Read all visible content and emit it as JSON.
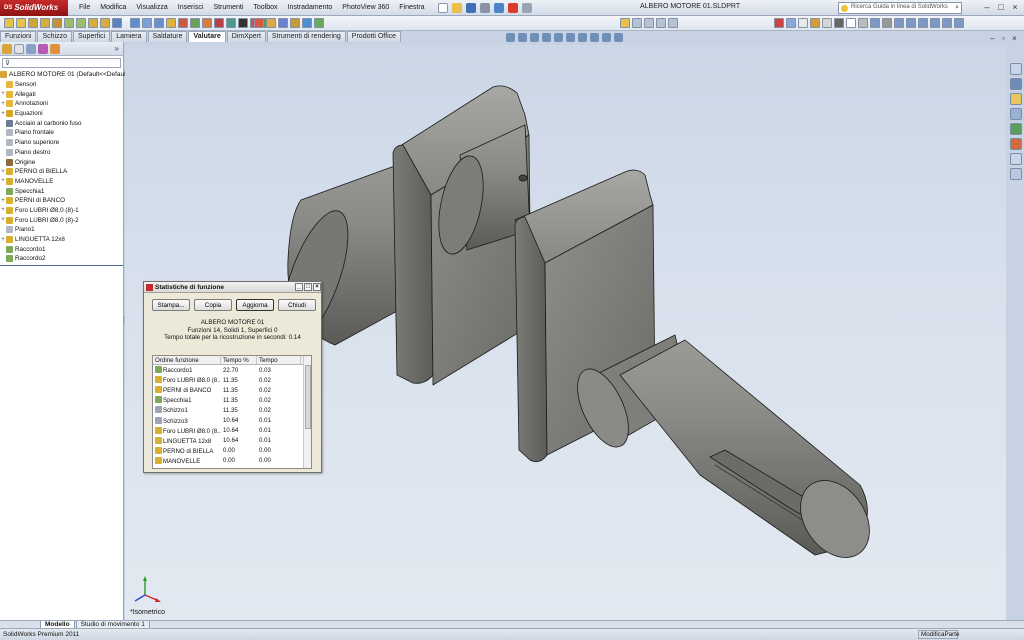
{
  "app": {
    "logo": "SolidWorks",
    "logo_prefix": "DS",
    "doc_title": "ALBERO MOTORE 01.SLDPRT"
  },
  "menu": [
    "File",
    "Modifica",
    "Visualizza",
    "Inserisci",
    "Strumenti",
    "Toolbox",
    "Instradamento",
    "PhotoView 360",
    "Finestra"
  ],
  "help_search": {
    "placeholder": "Ricerca Guida in linea di SolidWorks"
  },
  "command_tabs": [
    {
      "label": "Funzioni"
    },
    {
      "label": "Schizzo"
    },
    {
      "label": "Superfici"
    },
    {
      "label": "Lamiera"
    },
    {
      "label": "Saldature"
    },
    {
      "label": "Valutare",
      "active": true
    },
    {
      "label": "DimXpert"
    },
    {
      "label": "Strumenti di rendering"
    },
    {
      "label": "Prodotti Office"
    }
  ],
  "feature_tree": {
    "filter_icon": "filter-icon",
    "root": "ALBERO MOTORE 01  (Default<<Default>_",
    "items": [
      {
        "label": "Sensori",
        "icon": "sensor-icon",
        "color": "#e9b53c",
        "expand": ""
      },
      {
        "label": "Allegati",
        "icon": "attachment-icon",
        "color": "#e9b53c",
        "expand": "+"
      },
      {
        "label": "Annotazioni",
        "icon": "annotation-icon",
        "color": "#e9b53c",
        "expand": "+"
      },
      {
        "label": "Equazioni",
        "icon": "equation-icon",
        "color": "#d7a629",
        "expand": "+"
      },
      {
        "label": "Acciaio al carbonio fuso",
        "icon": "material-icon",
        "color": "#6b7a95",
        "expand": ""
      },
      {
        "label": "Piano frontale",
        "icon": "plane-icon",
        "color": "#b0b8c4",
        "expand": ""
      },
      {
        "label": "Piano superiore",
        "icon": "plane-icon",
        "color": "#b0b8c4",
        "expand": ""
      },
      {
        "label": "Piano destro",
        "icon": "plane-icon",
        "color": "#b0b8c4",
        "expand": ""
      },
      {
        "label": "Origine",
        "icon": "origin-icon",
        "color": "#8b6b3b",
        "expand": ""
      },
      {
        "label": "PERNO di BIELLA",
        "icon": "extrude-icon",
        "color": "#d7b030",
        "expand": "+"
      },
      {
        "label": "MANOVELLE",
        "icon": "extrude-icon",
        "color": "#d7b030",
        "expand": "+"
      },
      {
        "label": "Specchia1",
        "icon": "mirror-icon",
        "color": "#7ea85a",
        "expand": ""
      },
      {
        "label": "PERNI di BANCO",
        "icon": "extrude-icon",
        "color": "#d7b030",
        "expand": "+"
      },
      {
        "label": "Foro LUBRI Ø8.0 (8)-1",
        "icon": "hole-icon",
        "color": "#d7b030",
        "expand": "+"
      },
      {
        "label": "Foro LUBRI Ø8.0 (8)-2",
        "icon": "hole-icon",
        "color": "#d7b030",
        "expand": "+"
      },
      {
        "label": "Piano1",
        "icon": "plane-icon",
        "color": "#b0b8c4",
        "expand": ""
      },
      {
        "label": "LINGUETTA 12x8",
        "icon": "cut-icon",
        "color": "#d7b030",
        "expand": "+"
      },
      {
        "label": "Raccordo1",
        "icon": "fillet-icon",
        "color": "#7ea85a",
        "expand": ""
      },
      {
        "label": "Raccordo2",
        "icon": "fillet-icon",
        "color": "#7ea85a",
        "expand": ""
      }
    ]
  },
  "dialog": {
    "title": "Statistiche di funzione",
    "buttons": [
      "Stampa...",
      "Copia",
      "Aggiorna",
      "Chiudi"
    ],
    "part_name": "ALBERO MOTORE 01",
    "summary": "Funzioni 14, Solidi 1, Superfici 0",
    "rebuild_time": "Tempo totale per la ricostruzione in secondi: 0.14",
    "columns": [
      "Ordine funzione",
      "Tempo %",
      "Tempo"
    ],
    "rows": [
      {
        "name": "Raccordo1",
        "pct": "22.70",
        "time": "0.03",
        "icon": "fillet-icon",
        "color": "#7ea85a"
      },
      {
        "name": "Foro LUBRI Ø8.0 (8...",
        "pct": "11.35",
        "time": "0.02",
        "icon": "hole-icon",
        "color": "#d7b030"
      },
      {
        "name": "PERNI di BANCO",
        "pct": "11.35",
        "time": "0.02",
        "icon": "extrude-icon",
        "color": "#d7b030"
      },
      {
        "name": "Specchia1",
        "pct": "11.35",
        "time": "0.02",
        "icon": "mirror-icon",
        "color": "#7ea85a"
      },
      {
        "name": "Schizzo1",
        "pct": "11.35",
        "time": "0.02",
        "icon": "sketch-icon",
        "color": "#9aa4b5"
      },
      {
        "name": "Schizzo3",
        "pct": "10.64",
        "time": "0.01",
        "icon": "sketch-icon",
        "color": "#9aa4b5"
      },
      {
        "name": "Foro LUBRI Ø8.0 (8...",
        "pct": "10.64",
        "time": "0.01",
        "icon": "hole-icon",
        "color": "#d7b030"
      },
      {
        "name": "LINGUETTA 12x8",
        "pct": "10.64",
        "time": "0.01",
        "icon": "cut-icon",
        "color": "#d7b030"
      },
      {
        "name": "PERNO di BIELLA",
        "pct": "0.00",
        "time": "0.00",
        "icon": "extrude-icon",
        "color": "#d7b030"
      },
      {
        "name": "MANOVELLE",
        "pct": "0.00",
        "time": "0.00",
        "icon": "extrude-icon",
        "color": "#d7b030"
      }
    ]
  },
  "viewport": {
    "view_name": "*Isometrico"
  },
  "bottom_tabs": [
    {
      "label": "Modello",
      "active": true
    },
    {
      "label": "Studio di movimento 1"
    }
  ],
  "status": {
    "product": "SolidWorks Premium 2011",
    "mode": "ModificaParte"
  }
}
